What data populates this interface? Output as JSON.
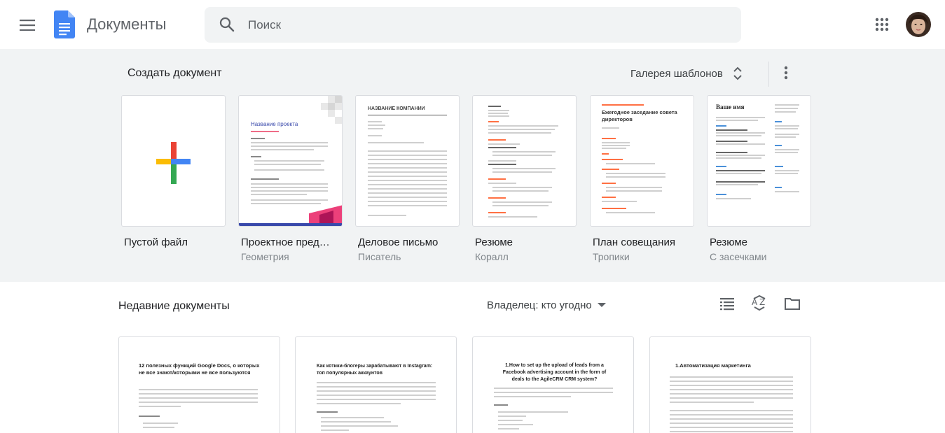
{
  "header": {
    "app_title": "Документы",
    "search_placeholder": "Поиск",
    "menu_icon": "hamburger-menu-icon",
    "apps_icon": "google-apps-grid-icon",
    "logo_color": "#4285f4"
  },
  "templates": {
    "section_title": "Создать документ",
    "gallery_label": "Галерея шаблонов",
    "items": [
      {
        "name": "Пустой файл",
        "subtitle": ""
      },
      {
        "name": "Проектное пред…",
        "subtitle": "Геометрия"
      },
      {
        "name": "Деловое письмо",
        "subtitle": "Писатель"
      },
      {
        "name": "Резюме",
        "subtitle": "Коралл"
      },
      {
        "name": "План совещания",
        "subtitle": "Тропики"
      },
      {
        "name": "Резюме",
        "subtitle": "С засечками"
      }
    ],
    "previews": {
      "project_title": "Название проекта",
      "company_name": "НАЗВАНИЕ КОМПАНИИ",
      "meeting_title": "Ежегодное заседание совета директоров",
      "your_name": "Ваше имя"
    }
  },
  "recent": {
    "section_title": "Недавние документы",
    "owner_filter": "Владелец: кто угодно",
    "docs": [
      {
        "title": "12 полезных функций Google Docs, о которых не все знают/которыми не все пользуются"
      },
      {
        "title": "Как котики-блогеры зарабатывают в Instagram: топ популярных аккаунтов"
      },
      {
        "title": "1.How to set up the upload of leads from a Facebook advertising account in the form of deals to the AgileCRM CRM system?"
      },
      {
        "title": "1.Автоматизация маркетинга"
      }
    ]
  },
  "colors": {
    "band_bg": "#f1f3f4",
    "plus_red": "#ea4335",
    "plus_blue": "#4285f4",
    "plus_green": "#34a853",
    "plus_yellow": "#fbbc04"
  }
}
